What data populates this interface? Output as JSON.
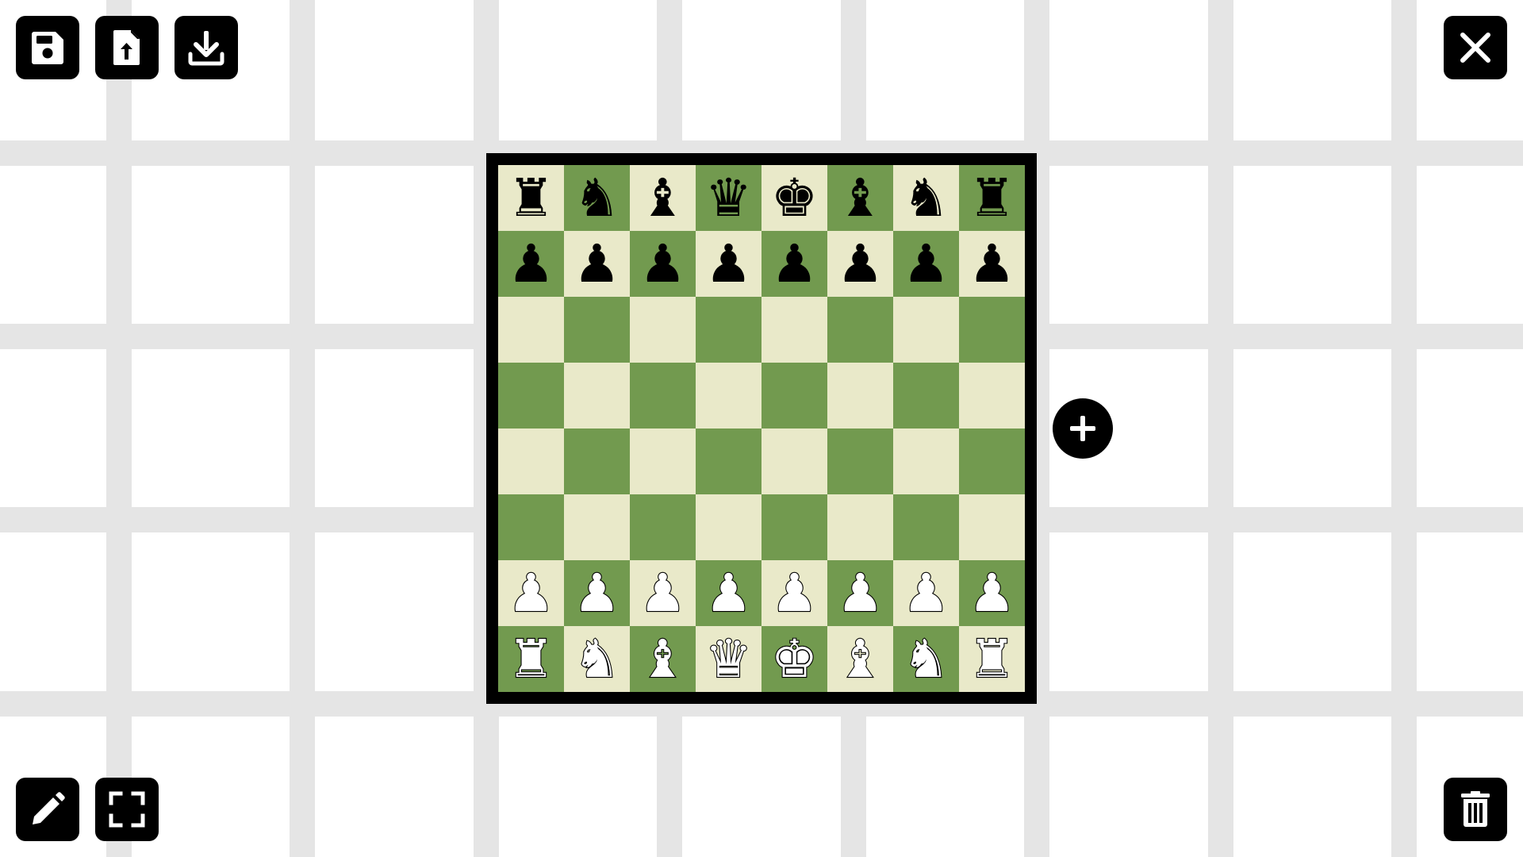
{
  "theme": {
    "light_square": "#e9e9c9",
    "dark_square": "#729a4f",
    "board_border": "#000000",
    "grid_line": "#e5e5e5",
    "button_bg": "#000000",
    "icon_color": "#ffffff"
  },
  "toolbar": {
    "top_left": [
      {
        "name": "save-button",
        "icon": "floppy-disk-icon"
      },
      {
        "name": "upload-file-button",
        "icon": "file-upload-icon"
      },
      {
        "name": "download-button",
        "icon": "download-icon"
      }
    ],
    "top_right": [
      {
        "name": "close-button",
        "icon": "close-icon"
      }
    ],
    "bottom_left": [
      {
        "name": "edit-button",
        "icon": "pencil-icon"
      },
      {
        "name": "fullscreen-button",
        "icon": "fullscreen-icon"
      }
    ],
    "bottom_right": [
      {
        "name": "delete-button",
        "icon": "trash-icon"
      }
    ],
    "add": {
      "name": "add-board-button",
      "icon": "plus-circle-icon"
    }
  },
  "board": {
    "ranks": [
      [
        "r",
        "n",
        "b",
        "q",
        "k",
        "b",
        "n",
        "r"
      ],
      [
        "p",
        "p",
        "p",
        "p",
        "p",
        "p",
        "p",
        "p"
      ],
      [
        "",
        "",
        "",
        "",
        "",
        "",
        "",
        ""
      ],
      [
        "",
        "",
        "",
        "",
        "",
        "",
        "",
        ""
      ],
      [
        "",
        "",
        "",
        "",
        "",
        "",
        "",
        ""
      ],
      [
        "",
        "",
        "",
        "",
        "",
        "",
        "",
        ""
      ],
      [
        "P",
        "P",
        "P",
        "P",
        "P",
        "P",
        "P",
        "P"
      ],
      [
        "R",
        "N",
        "B",
        "Q",
        "K",
        "B",
        "N",
        "R"
      ]
    ],
    "piece_names": {
      "k": "king",
      "q": "queen",
      "r": "rook",
      "b": "bishop",
      "n": "knight",
      "p": "pawn"
    }
  }
}
